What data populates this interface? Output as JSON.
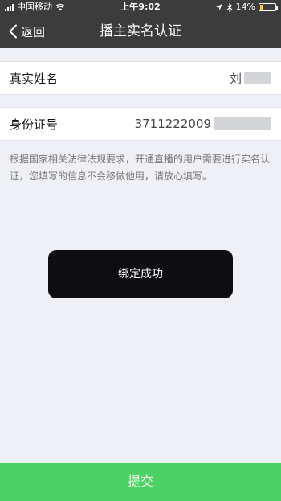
{
  "status_bar": {
    "carrier": "中国移动",
    "time": "上午9:02",
    "battery_percent": "14%",
    "battery_level": 0.14
  },
  "nav": {
    "back_label": "返回",
    "title": "播主实名认证"
  },
  "form": {
    "name_label": "真实姓名",
    "name_value": "刘",
    "id_label": "身份证号",
    "id_value": "3711222009"
  },
  "notice": "根据国家相关法律法规要求，开通直播的用户需要进行实名认证，您填写的信息不会移做他用，请放心填写。",
  "toast": "绑定成功",
  "submit_label": "提交",
  "colors": {
    "nav_bg": "#3c3c3c",
    "submit_bg": "#4cd164",
    "toast_bg": "#0e0e12",
    "page_bg": "#eef0f5"
  },
  "icons": [
    "signal-icon",
    "wifi-icon",
    "location-icon",
    "bluetooth-icon",
    "battery-icon",
    "chevron-left-icon"
  ]
}
